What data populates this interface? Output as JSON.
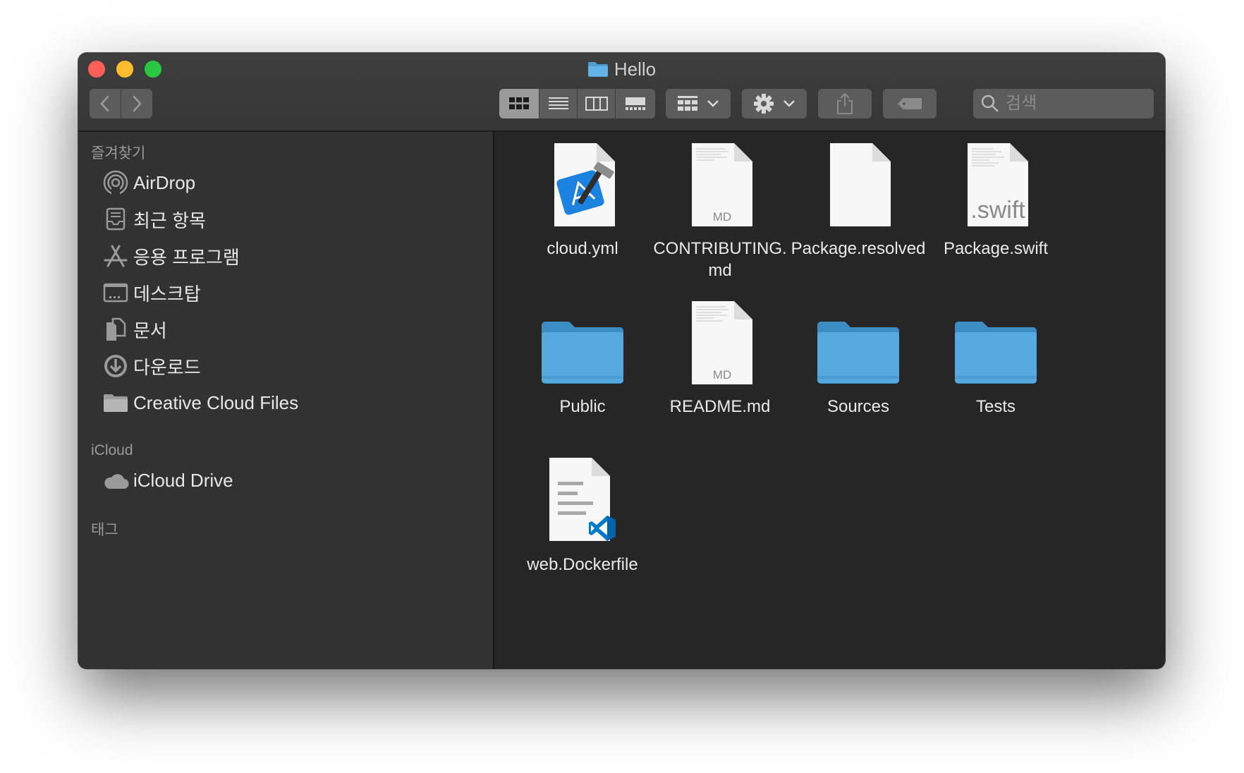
{
  "window": {
    "title": "Hello"
  },
  "toolbar": {
    "back_icon": "chevron-left-icon",
    "forward_icon": "chevron-right-icon",
    "view_modes": [
      "icon-view",
      "list-view",
      "column-view",
      "gallery-view"
    ],
    "active_view": "icon-view",
    "search_placeholder": "검색"
  },
  "sidebar": {
    "favorites_title": "즐겨찾기",
    "favorites": [
      {
        "label": "AirDrop",
        "icon": "airdrop-icon"
      },
      {
        "label": "최근 항목",
        "icon": "recents-icon"
      },
      {
        "label": "응용 프로그램",
        "icon": "applications-icon"
      },
      {
        "label": "데스크탑",
        "icon": "desktop-icon"
      },
      {
        "label": "문서",
        "icon": "documents-icon"
      },
      {
        "label": "다운로드",
        "icon": "downloads-icon"
      },
      {
        "label": "Creative Cloud Files",
        "icon": "folder-icon"
      }
    ],
    "icloud_title": "iCloud",
    "icloud": [
      {
        "label": "iCloud Drive",
        "icon": "cloud-icon"
      }
    ],
    "tags_title": "태그"
  },
  "files": [
    {
      "name": "cloud.yml",
      "icon": "xcode-document-icon"
    },
    {
      "name": "CONTRIBUTING.\nmd",
      "icon": "markdown-document-icon",
      "badge": "MD"
    },
    {
      "name": "Package.resolved",
      "icon": "blank-document-icon"
    },
    {
      "name": "Package.swift",
      "icon": "swift-document-icon",
      "badge": ".swift"
    },
    {
      "name": "Public",
      "icon": "folder-icon"
    },
    {
      "name": "README.md",
      "icon": "markdown-document-icon",
      "badge": "MD"
    },
    {
      "name": "Sources",
      "icon": "folder-icon"
    },
    {
      "name": "Tests",
      "icon": "folder-icon"
    },
    {
      "name": "web.Dockerfile",
      "icon": "vscode-document-icon"
    }
  ],
  "colors": {
    "close": "#fe5f57",
    "minimize": "#febc2e",
    "zoom": "#28c840",
    "folder": "#4a9fd6",
    "sidebar_bg": "#323232",
    "content_bg": "#262626"
  }
}
